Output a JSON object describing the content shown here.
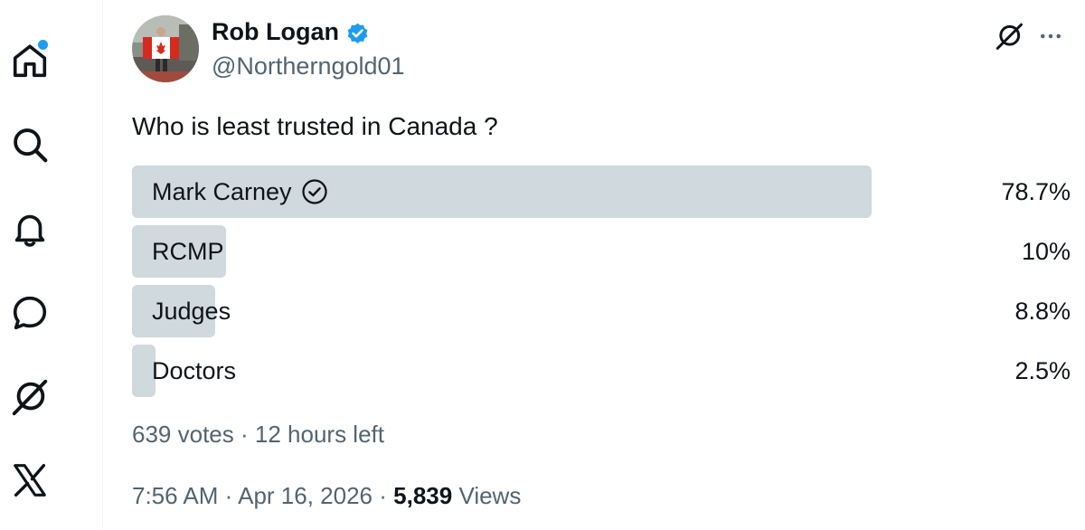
{
  "sidebar": {
    "items": [
      {
        "name": "home",
        "icon": "home-icon",
        "has_notification_dot": true
      },
      {
        "name": "explore",
        "icon": "search-icon"
      },
      {
        "name": "notifications",
        "icon": "bell-icon"
      },
      {
        "name": "messages",
        "icon": "chat-bubble-icon"
      },
      {
        "name": "grok",
        "icon": "grok-icon"
      },
      {
        "name": "premium",
        "icon": "x-logo-icon"
      }
    ],
    "accent": "#1d9bf0"
  },
  "post": {
    "author": {
      "name": "Rob Logan",
      "handle": "@Northerngold01",
      "verified": true,
      "verified_color": "#1d9bf0"
    },
    "text": "Who is least trusted in Canada ?",
    "poll": {
      "options": [
        {
          "label": "Mark Carney",
          "percent": 78.7,
          "percent_label": "78.7%",
          "winner": true
        },
        {
          "label": "RCMP",
          "percent": 10,
          "percent_label": "10%",
          "winner": false
        },
        {
          "label": "Judges",
          "percent": 8.8,
          "percent_label": "8.8%",
          "winner": false
        },
        {
          "label": "Doctors",
          "percent": 2.5,
          "percent_label": "2.5%",
          "winner": false
        }
      ],
      "votes": "639 votes",
      "separator": "·",
      "time_left": "12 hours left",
      "bar_color": "#cfd9de"
    },
    "time": "7:56 AM",
    "date": "Apr 16, 2026",
    "separator": "·",
    "views_count": "5,839",
    "views_label": "Views"
  }
}
